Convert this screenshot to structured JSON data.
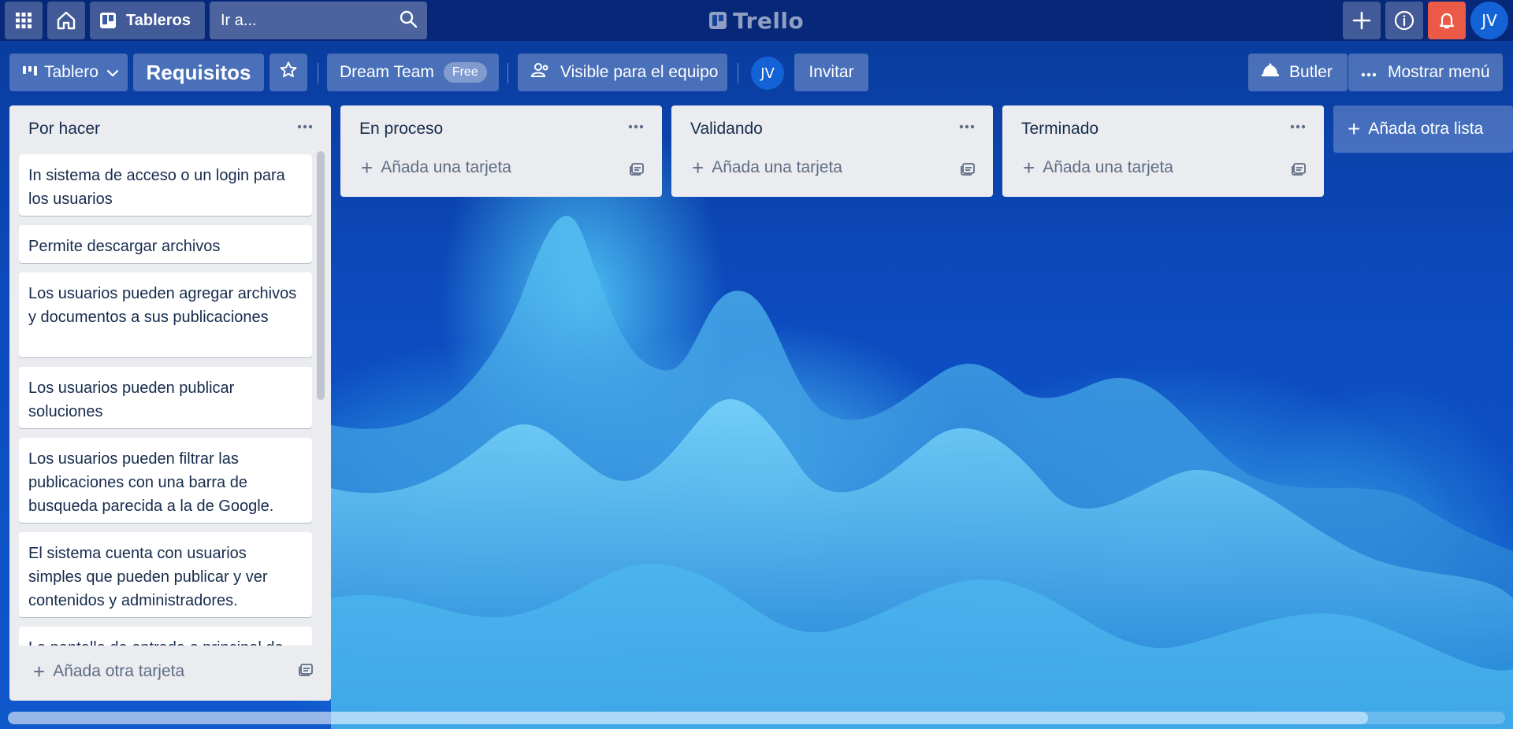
{
  "topbar": {
    "boards_label": "Tableros",
    "search_placeholder": "Ir a...",
    "logo_text": "Trello",
    "user_initials": "JV"
  },
  "board_header": {
    "view_label": "Tablero",
    "board_name": "Requisitos",
    "team_name": "Dream Team",
    "team_plan": "Free",
    "visibility_label": "Visible para el equipo",
    "member_initials": "JV",
    "invite_label": "Invitar",
    "butler_label": "Butler",
    "show_menu_label": "Mostrar menú"
  },
  "lists": [
    {
      "title": "Por hacer",
      "cards": [
        "In sistema de acceso o un login para los usuarios",
        "Permite descargar archivos",
        "Los usuarios pueden agregar archivos y documentos a sus publicaciones",
        "Los usuarios pueden publicar soluciones",
        "Los usuarios pueden filtrar las publicaciones con una barra de busqueda parecida a la de Google.",
        "El sistema cuenta con usuarios simples que pueden publicar y ver contenidos y administradores.",
        "La pantalla de entrada o principal de"
      ],
      "add_label": "Añada otra tarjeta"
    },
    {
      "title": "En proceso",
      "cards": [],
      "add_label": "Añada una tarjeta"
    },
    {
      "title": "Validando",
      "cards": [],
      "add_label": "Añada una tarjeta"
    },
    {
      "title": "Terminado",
      "cards": [],
      "add_label": "Añada una tarjeta"
    }
  ],
  "add_list_label": "Añada otra lista",
  "colors": {
    "notification": "#eb5a46",
    "avatar": "#1463d6",
    "list_bg": "#ebecf0"
  }
}
